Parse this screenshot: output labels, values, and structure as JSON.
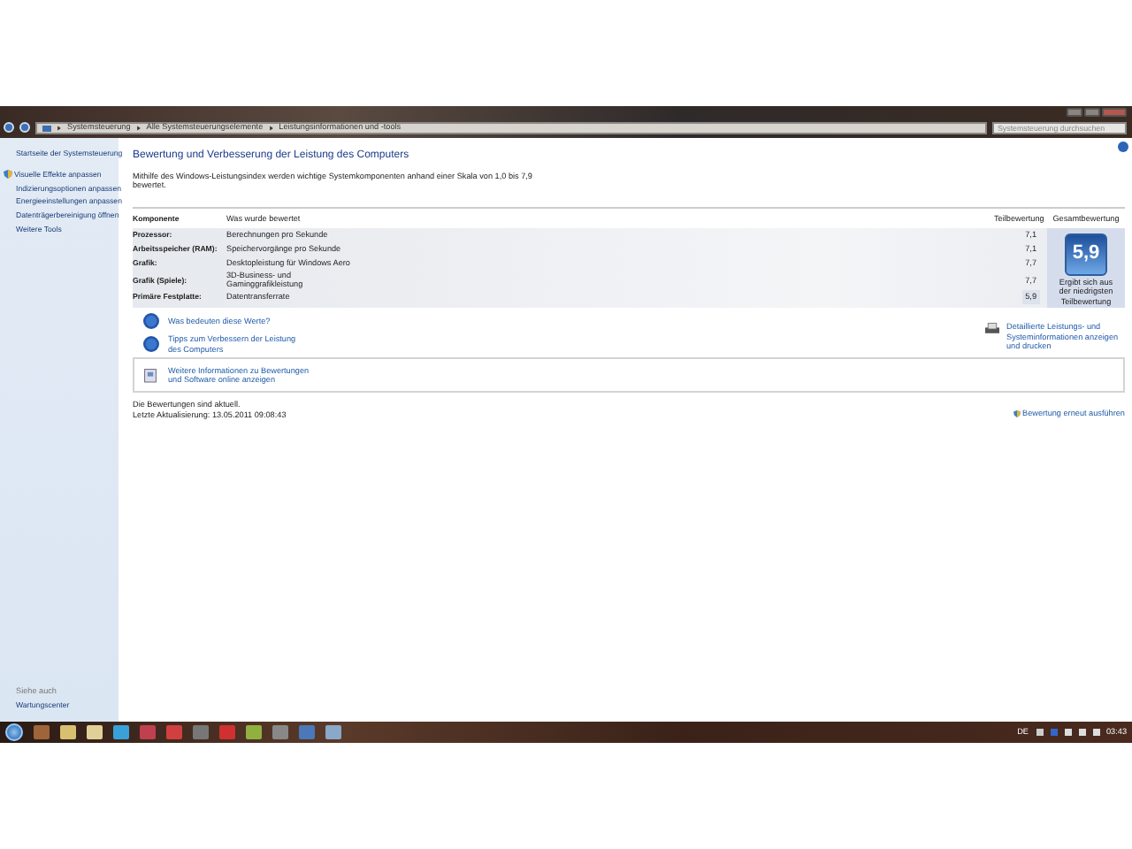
{
  "address_bar": {
    "breadcrumb": [
      "Systemsteuerung",
      "Alle Systemsteuerungselemente",
      "Leistungsinformationen und -tools"
    ],
    "search": {
      "placeholder": "Systemsteuerung durchsuchen"
    }
  },
  "sidebar": {
    "items": [
      {
        "label": "Startseite der Systemsteuerung",
        "kind": "home"
      },
      {
        "label": "Visuelle Effekte anpassen",
        "kind": "shield"
      },
      {
        "label": "Indizierungsoptionen anpassen",
        "kind": "link"
      },
      {
        "label": "Energieeinstellungen anpassen",
        "kind": "link"
      },
      {
        "label": "Datenträgerbereinigung öffnen",
        "kind": "link"
      },
      {
        "label": "Weitere Tools",
        "kind": "link"
      }
    ],
    "see_also": {
      "heading": "Siehe auch",
      "items": [
        "Wartungscenter"
      ]
    }
  },
  "content": {
    "title": "Bewertung und Verbesserung der Leistung des Computers",
    "description": "Mithilfe des Windows-Leistungsindex werden wichtige Systemkomponenten anhand einer Skala von 1,0 bis 7,9 bewertet.",
    "table": {
      "columns": [
        "Komponente",
        "Was wurde bewertet",
        "Teilbewertung",
        "Gesamtbewertung"
      ],
      "rows": [
        {
          "component": "Prozessor:",
          "measured": "Berechnungen pro Sekunde",
          "subscore": "7,1",
          "lowest": false
        },
        {
          "component": "Arbeitsspeicher (RAM):",
          "measured": "Speichervorgänge pro Sekunde",
          "subscore": "7,1",
          "lowest": false
        },
        {
          "component": "Grafik:",
          "measured": "Desktopleistung für Windows Aero",
          "subscore": "7,7",
          "lowest": false
        },
        {
          "component": "Grafik (Spiele):",
          "measured": "3D-Business- und Gaminggrafikleistung",
          "subscore": "7,7",
          "lowest": false
        },
        {
          "component": "Primäre Festplatte:",
          "measured": "Datentransferrate",
          "subscore": "5,9",
          "lowest": true
        }
      ]
    },
    "base_score": {
      "value": "5,9",
      "caption": "Ergibt sich aus der niedrigsten Teilbewertung"
    },
    "help_links": [
      "Was bedeuten diese Werte?",
      "Tipps zum Verbessern der Leistung des Computers"
    ],
    "print_link": "Detaillierte Leistungs- und Systeminformationen anzeigen und drucken",
    "info_box": {
      "text": "Weitere Informationen zu Bewertungen und Software online anzeigen"
    },
    "status": [
      "Die Bewertungen sind aktuell.",
      "Letzte Aktualisierung: 13.05.2011 09:08:43"
    ],
    "rerun_link": "Bewertung erneut ausführen"
  },
  "taskbar": {
    "language": "DE",
    "clock": "03:43"
  }
}
